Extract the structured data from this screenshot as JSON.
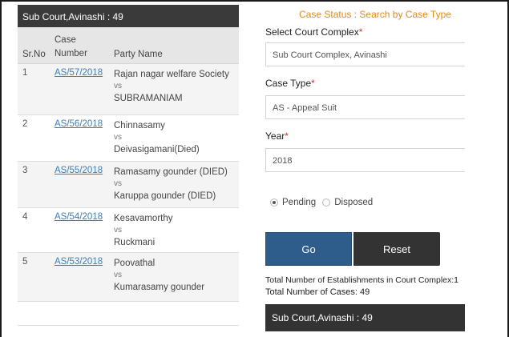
{
  "left_panel": {
    "header": "Sub Court,Avinashi : 49",
    "columns": {
      "srno": "Sr.No",
      "case_line1": "Case",
      "case_line2": "Number",
      "party": "Party Name"
    },
    "rows": [
      {
        "sr": "1",
        "case": "AS/57/2018",
        "party1": "Rajan nagar welfare Society",
        "vs": "vs",
        "party2": "SUBRAMANIAM"
      },
      {
        "sr": "2",
        "case": "AS/56/2018",
        "party1": "Chinnasamy",
        "vs": "vs",
        "party2": "Deivasigamani(Died)"
      },
      {
        "sr": "3",
        "case": "AS/55/2018",
        "party1": "Ramasamy gounder (DIED)",
        "vs": "vs",
        "party2": "Karuppa gounder (DIED)"
      },
      {
        "sr": "4",
        "case": "AS/54/2018",
        "party1": "Kesavamorthy",
        "vs": "vs",
        "party2": "Ruckmani"
      },
      {
        "sr": "5",
        "case": "AS/53/2018",
        "party1": "Poovathal",
        "vs": "vs",
        "party2": "Kumarasamy gounder"
      }
    ]
  },
  "right_panel": {
    "title": "Case Status : Search by Case Type",
    "court_complex_label": "Select Court Complex",
    "court_complex_value": "Sub Court Complex, Avinashi",
    "case_type_label": "Case Type",
    "case_type_value": "AS - Appeal Suit",
    "year_label": "Year",
    "year_value": "2018",
    "required_mark": "*",
    "radio_pending": "Pending",
    "radio_disposed": "Disposed",
    "go_label": "Go",
    "reset_label": "Reset",
    "total_establishments": "Total Number of Establishments in Court Complex:1",
    "total_cases": "Total Number of Cases: 49",
    "bottom_header": "Sub Court,Avinashi : 49"
  },
  "colors": {
    "accent_title": "#e08a1e",
    "link": "#3a7fb8",
    "go_button": "#2e5d8c",
    "dark_bar": "#333333"
  }
}
